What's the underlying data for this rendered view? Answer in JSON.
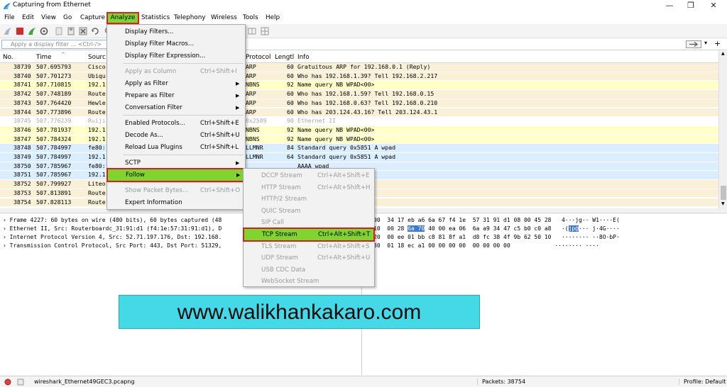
{
  "window": {
    "title": "Capturing from Ethernet",
    "minimize": "—",
    "maximize": "❐",
    "close": "✕"
  },
  "menubar": [
    "File",
    "Edit",
    "View",
    "Go",
    "Capture",
    "Analyze",
    "Statistics",
    "Telephony",
    "Wireless",
    "Tools",
    "Help"
  ],
  "filter": {
    "placeholder": "Apply a display filter ... <Ctrl-/>",
    "plus": "+"
  },
  "columns": [
    "No.",
    "Time",
    "Source",
    "Protocol",
    "Length",
    "Info"
  ],
  "columns_display": {
    "no": "No.",
    "time": "Time",
    "source": "Sourc",
    "protocol": "Protocol",
    "length": "Lengtl",
    "info": "Info"
  },
  "packets": [
    {
      "no": "38739",
      "time": "507.695793",
      "source": "Cisco",
      "protocol": "ARP",
      "length": "60",
      "info": "Gratuitous ARP for 192.168.0.1 (Reply)"
    },
    {
      "no": "38740",
      "time": "507.701273",
      "source": "Ubiqu",
      "protocol": "ARP",
      "length": "60",
      "info": "Who has 192.168.1.39? Tell 192.168.2.217"
    },
    {
      "no": "38741",
      "time": "507.710815",
      "source": "192.1",
      "protocol": "NBNS",
      "length": "92",
      "info": "Name query NB WPAD<00>"
    },
    {
      "no": "38742",
      "time": "507.748189",
      "source": "Route",
      "protocol": "ARP",
      "length": "60",
      "info": "Who has 192.168.1.59? Tell 192.168.0.15"
    },
    {
      "no": "38743",
      "time": "507.764420",
      "source": "Hewle",
      "protocol": "ARP",
      "length": "60",
      "info": "Who has 192.168.0.63? Tell 192.168.0.210"
    },
    {
      "no": "38744",
      "time": "507.773896",
      "source": "Route",
      "protocol": "ARP",
      "length": "60",
      "info": "Who has 203.124.43.16? Tell 203.124.43.1"
    },
    {
      "no": "38745",
      "time": "507.776239",
      "source": "Ruiji",
      "protocol": "0x2589",
      "length": "90",
      "info": "Ethernet II"
    },
    {
      "no": "38746",
      "time": "507.781937",
      "source": "192.1",
      "protocol": "NBNS",
      "length": "92",
      "info": "Name query NB WPAD<00>"
    },
    {
      "no": "38747",
      "time": "507.784324",
      "source": "192.1",
      "protocol": "NBNS",
      "length": "92",
      "info": "Name query NB WPAD<00>"
    },
    {
      "no": "38748",
      "time": "507.784997",
      "source": "fe80:",
      "protocol": "LLMNR",
      "length": "84",
      "info": "Standard query 0x5851 A wpad"
    },
    {
      "no": "38749",
      "time": "507.784997",
      "source": "192.1",
      "protocol": "LLMNR",
      "length": "64",
      "info": "Standard query 0x5851 A wpad"
    },
    {
      "no": "38750",
      "time": "507.785967",
      "source": "fe80:",
      "protocol": "",
      "length": "",
      "info": "AAAA wpad"
    },
    {
      "no": "38751",
      "time": "507.785967",
      "source": "192.1",
      "protocol": "",
      "length": "",
      "info": "AAAA wpad"
    },
    {
      "no": "38752",
      "time": "507.799927",
      "source": "Liteo",
      "protocol": "",
      "length": "",
      "info": "Tell 192.168.0.124"
    },
    {
      "no": "38753",
      "time": "507.813891",
      "source": "Route",
      "protocol": "",
      "length": "",
      "info": "? Tell 203.124.43.1"
    },
    {
      "no": "38754",
      "time": "507.828113",
      "source": "Route",
      "protocol": "",
      "length": "",
      "info": "? Tell 192.168.0.15"
    }
  ],
  "details": [
    "Frame 4227: 60 bytes on wire (480 bits), 60 bytes captured (48",
    "Ethernet II, Src: Routerboardc_31:91:d1 (f4:1e:57:31:91:d1), D",
    "Internet Protocol Version 4, Src: 52.71.197.176, Dst: 192.168.",
    "Transmission Control Protocol, Src Port: 443, Dst Port: 51329,"
  ],
  "bytes": [
    {
      "offset": "00",
      "a": "34 17 eb a6 6a 67 f4 1e",
      "b": "57 31 91 d1 08 00 45 28",
      "ascii": "4···jg·· W1····E("
    },
    {
      "offset": "10",
      "a_pre": "00 28 ",
      "a_hl": "6a 70",
      "a_post": " 40 00 ea 06",
      "b": "6a a9 34 47 c5 b0 c0 a8",
      "ascii_pre": "·(",
      "ascii_hl": "jp@",
      "ascii_post": "··· j·4G····"
    },
    {
      "offset": "20",
      "a": "00 ee 01 bb c8 81 8f a1",
      "b": "d8 fc 38 4f 9b 62 50 10",
      "ascii": "········ ··8O·bP·"
    },
    {
      "offset": "30",
      "a": "01 18 ec a1 00 00 00 00",
      "b": "00 00 00 00",
      "ascii": "········ ····"
    }
  ],
  "analyze_menu": {
    "items": [
      {
        "label": "Display Filters...",
        "shortcut": "",
        "disabled": false,
        "submenu": false
      },
      {
        "label": "Display Filter Macros...",
        "shortcut": "",
        "disabled": false,
        "submenu": false
      },
      {
        "label": "Display Filter Expression...",
        "shortcut": "",
        "disabled": false,
        "submenu": false
      },
      {
        "label": "Apply as Column",
        "shortcut": "Ctrl+Shift+I",
        "disabled": true,
        "submenu": false
      },
      {
        "label": "Apply as Filter",
        "shortcut": "",
        "disabled": false,
        "submenu": true
      },
      {
        "label": "Prepare as Filter",
        "shortcut": "",
        "disabled": false,
        "submenu": true
      },
      {
        "label": "Conversation Filter",
        "shortcut": "",
        "disabled": false,
        "submenu": true
      },
      {
        "label": "Enabled Protocols...",
        "shortcut": "Ctrl+Shift+E",
        "disabled": false,
        "submenu": false
      },
      {
        "label": "Decode As...",
        "shortcut": "Ctrl+Shift+U",
        "disabled": false,
        "submenu": false
      },
      {
        "label": "Reload Lua Plugins",
        "shortcut": "Ctrl+Shift+L",
        "disabled": false,
        "submenu": false
      },
      {
        "label": "SCTP",
        "shortcut": "",
        "disabled": false,
        "submenu": true
      },
      {
        "label": "Follow",
        "shortcut": "",
        "disabled": false,
        "submenu": true
      },
      {
        "label": "Show Packet Bytes...",
        "shortcut": "Ctrl+Shift+O",
        "disabled": true,
        "submenu": false
      },
      {
        "label": "Expert Information",
        "shortcut": "",
        "disabled": false,
        "submenu": false
      }
    ]
  },
  "follow_menu": {
    "items": [
      {
        "label": "DCCP Stream",
        "shortcut": "Ctrl+Alt+Shift+E",
        "disabled": true
      },
      {
        "label": "HTTP Stream",
        "shortcut": "Ctrl+Alt+Shift+H",
        "disabled": true
      },
      {
        "label": "HTTP/2 Stream",
        "shortcut": "",
        "disabled": true
      },
      {
        "label": "QUIC Stream",
        "shortcut": "",
        "disabled": true
      },
      {
        "label": "SIP Call",
        "shortcut": "",
        "disabled": true
      },
      {
        "label": "TCP Stream",
        "shortcut": "Ctrl+Alt+Shift+T",
        "disabled": false
      },
      {
        "label": "TLS Stream",
        "shortcut": "Ctrl+Alt+Shift+S",
        "disabled": true
      },
      {
        "label": "UDP Stream",
        "shortcut": "Ctrl+Alt+Shift+U",
        "disabled": true
      },
      {
        "label": "USB CDC Data",
        "shortcut": "",
        "disabled": true
      },
      {
        "label": "WebSocket Stream",
        "shortcut": "",
        "disabled": true
      }
    ]
  },
  "watermark": "www.walikhankakaro.com",
  "status": {
    "file": "wireshark_Ethernet49GEC3.pcapng",
    "packets": "Packets: 38754",
    "profile": "Profile: Default"
  },
  "colors": {
    "highlight_green": "#7fd42f",
    "highlight_border": "#d81e1e",
    "arp_row": "#faf0d7",
    "nbns_row": "#ffffc8",
    "llmnr_row": "#daeeff",
    "watermark_bg": "#44d9e6"
  }
}
